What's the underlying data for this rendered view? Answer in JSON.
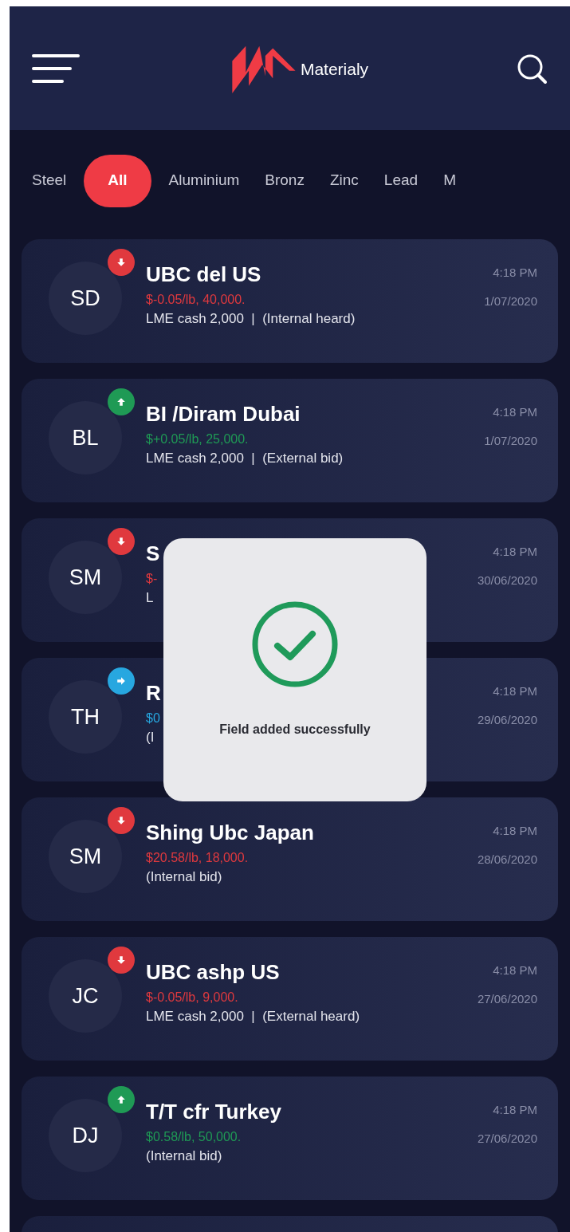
{
  "header": {
    "app_name": "Materialy"
  },
  "tabs": [
    {
      "label": "Steel",
      "selected": false
    },
    {
      "label": "All",
      "selected": true
    },
    {
      "label": "Aluminium",
      "selected": false
    },
    {
      "label": "Bronz",
      "selected": false
    },
    {
      "label": "Zinc",
      "selected": false
    },
    {
      "label": "Lead",
      "selected": false
    },
    {
      "label": "M",
      "selected": false
    }
  ],
  "listings": [
    {
      "initials": "SD",
      "kind": "down",
      "color": "#e0393e",
      "title": "UBC del US",
      "price": "$-0.05/lb, 40,000.",
      "details": "LME cash 2,000  |  (Internal heard)",
      "time": "4:18 PM",
      "date": "1/07/2020"
    },
    {
      "initials": "BL",
      "kind": "up",
      "color": "#1f9a55",
      "title": "BI /Diram Dubai",
      "price": "$+0.05/lb, 25,000.",
      "details": "LME cash 2,000  |  (External bid)",
      "time": "4:18 PM",
      "date": "1/07/2020"
    },
    {
      "initials": "SM",
      "kind": "down",
      "color": "#e0393e",
      "title": "S",
      "price": "$-",
      "details": "L",
      "time": "4:18 PM",
      "date": "30/06/2020"
    },
    {
      "initials": "TH",
      "kind": "right",
      "color": "#27a7e0",
      "title": "R",
      "price": "$0",
      "details": "(I",
      "time": "4:18 PM",
      "date": "29/06/2020"
    },
    {
      "initials": "SM",
      "kind": "down",
      "color": "#e0393e",
      "title": "Shing Ubc Japan",
      "price": "$20.58/lb, 18,000.",
      "details": "(Internal bid)",
      "time": "4:18 PM",
      "date": "28/06/2020"
    },
    {
      "initials": "JC",
      "kind": "down",
      "color": "#e0393e",
      "title": "UBC ashp US",
      "price": "$-0.05/lb, 9,000.",
      "details": "LME cash 2,000  |  (External heard)",
      "time": "4:18 PM",
      "date": "27/06/2020"
    },
    {
      "initials": "DJ",
      "kind": "up",
      "color": "#1f9a55",
      "title": "T/T cfr Turkey",
      "price": "$0.58/lb, 50,000.",
      "details": "(Internal bid)",
      "time": "4:18 PM",
      "date": "27/06/2020"
    }
  ],
  "toast": {
    "message": "Field added successfully"
  }
}
